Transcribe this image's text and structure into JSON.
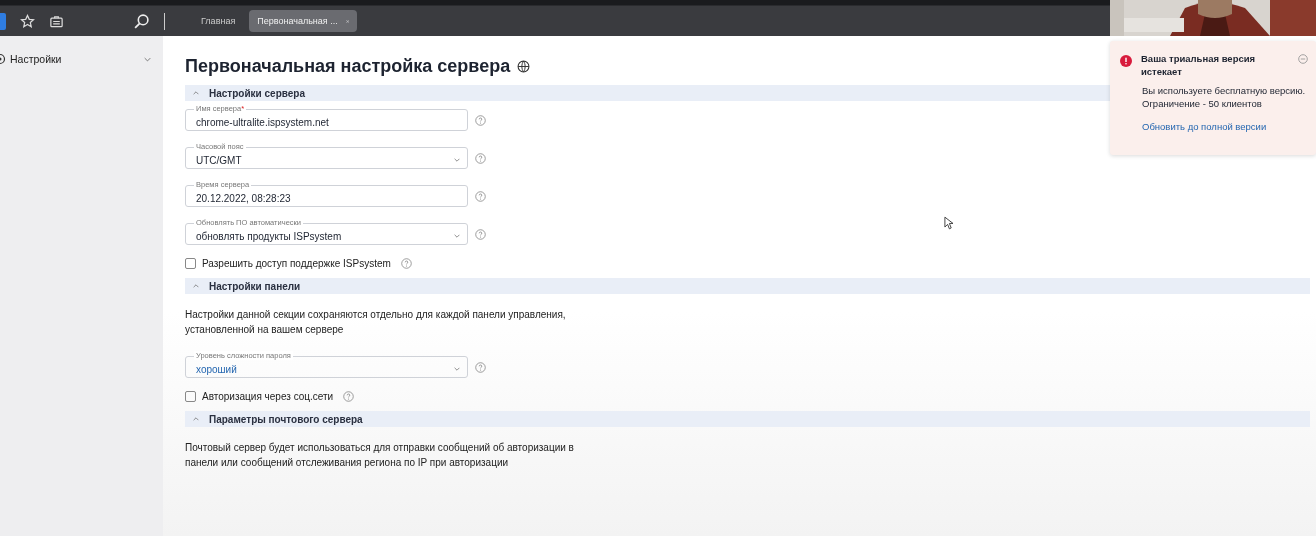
{
  "browser": {
    "tabs": [
      {
        "label": "Главная",
        "selected": false
      },
      {
        "label": "Первоначальная ...",
        "selected": true
      }
    ]
  },
  "sidebar": {
    "items": [
      {
        "label": "Настройки",
        "expanded": false
      }
    ]
  },
  "page": {
    "title": "Первоначальная настройка сервера",
    "sections": [
      {
        "title": "Настройки сервера",
        "expanded": true,
        "items": [
          {
            "kind": "text",
            "label": "Имя сервера",
            "required_mark": "*",
            "value": "chrome-ultralite.ispsystem.net"
          },
          {
            "kind": "select",
            "label": "Часовой пояс",
            "value": "UTC/GMT",
            "highlighted": false
          },
          {
            "kind": "text",
            "label": "Время сервера",
            "value": "20.12.2022, 08:28:23"
          },
          {
            "kind": "select",
            "label": "Обновлять ПО автоматически",
            "value": "обновлять продукты ISPsystem",
            "highlighted": false
          },
          {
            "kind": "checkbox",
            "label": "Разрешить доступ поддержке ISPsystem",
            "checked": false
          }
        ]
      },
      {
        "title": "Настройки панели",
        "expanded": true,
        "items": [
          {
            "kind": "note",
            "text": "Настройки данной секции сохраняются отдельно для каждой панели управления, установленной на вашем сервере"
          },
          {
            "kind": "select",
            "label": "Уровень сложности пароля",
            "value": "хороший",
            "highlighted": true
          },
          {
            "kind": "checkbox",
            "label": "Авторизация через соц.сети",
            "checked": false
          }
        ]
      },
      {
        "title": "Параметры почтового сервера",
        "expanded": true,
        "items": [
          {
            "kind": "note",
            "text": "Почтовый сервер будет использоваться для отправки сообщений об авторизации в панели или сообщений отслеживания региона по IP при авторизации"
          }
        ]
      }
    ]
  },
  "notification": {
    "title": "Ваша триальная версия истекает",
    "body": "Вы используете бесплатную версию. Ограничение - 50 клиентов",
    "link": "Обновить до полной версии"
  }
}
